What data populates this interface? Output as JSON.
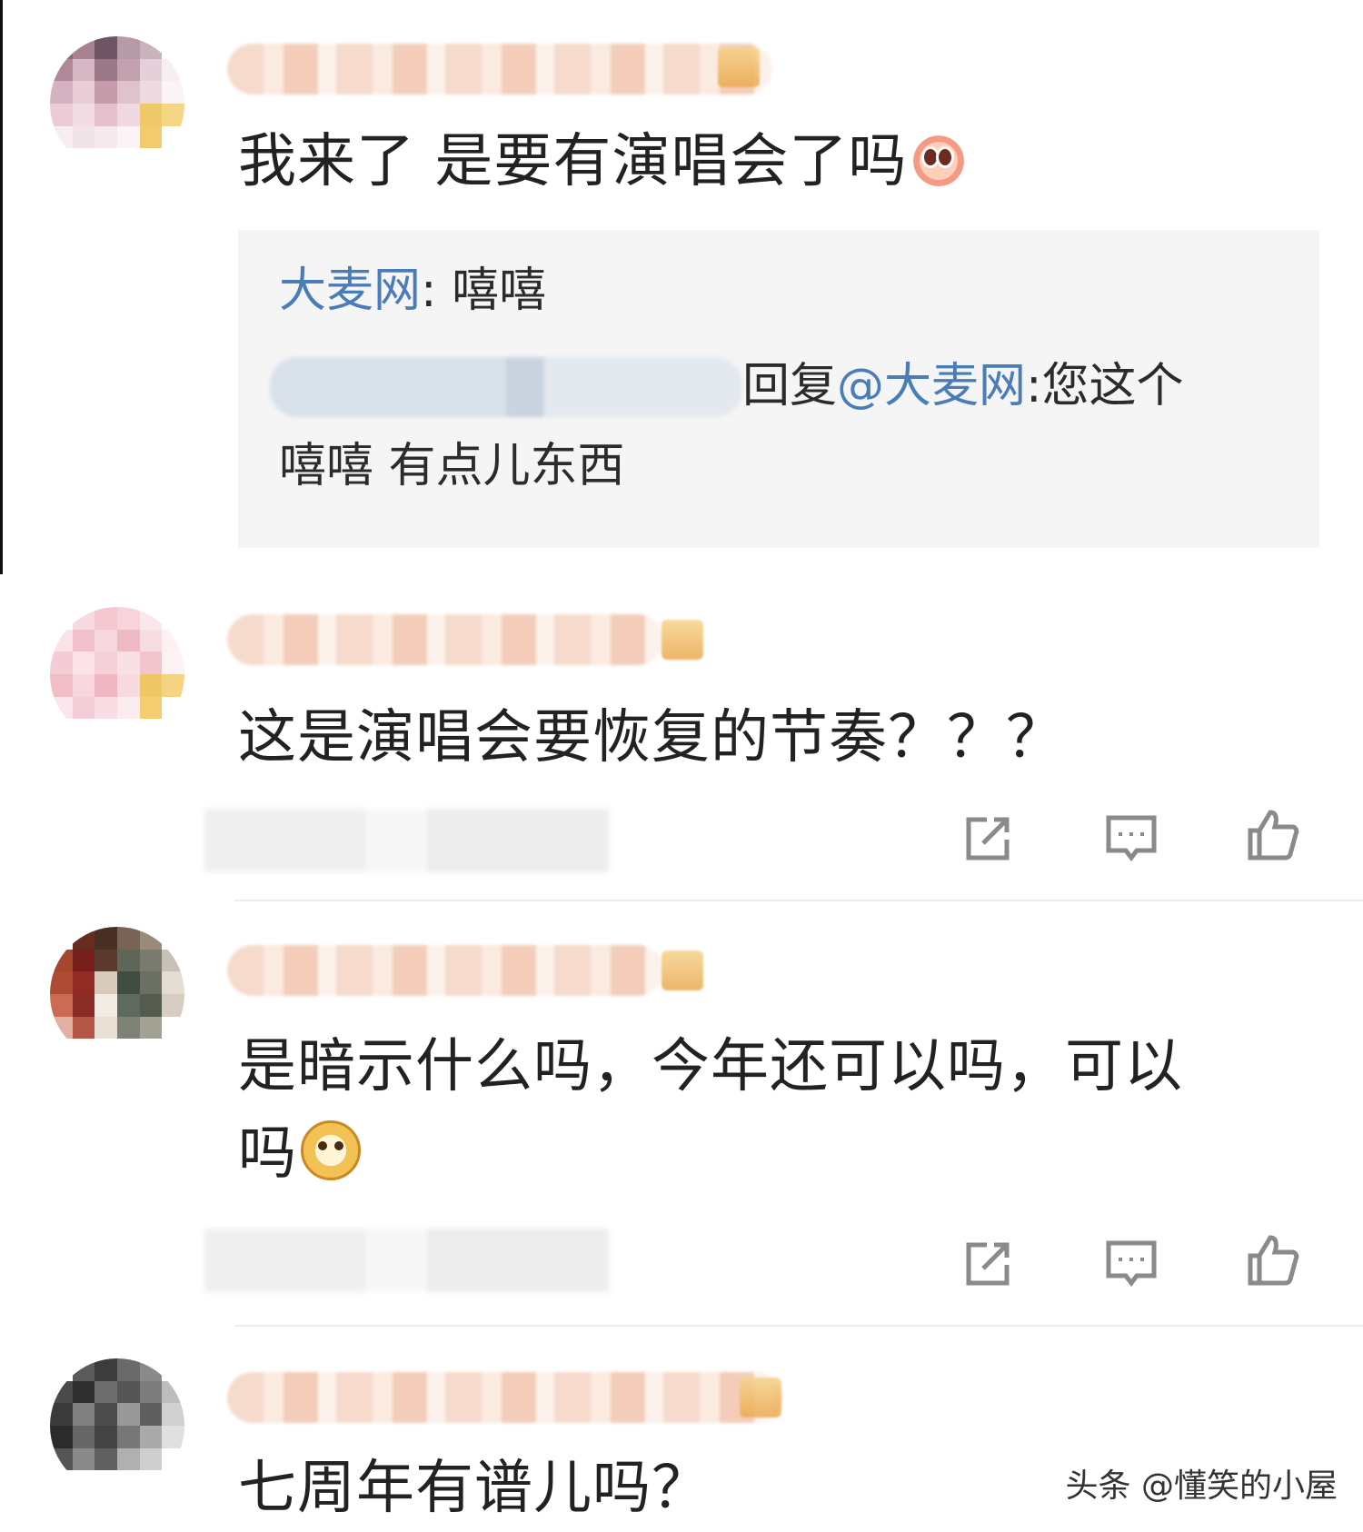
{
  "comments": [
    {
      "text": "我来了 是要有演唱会了吗",
      "emoji": "shy-face-emoji",
      "reply": {
        "line1_author": "大麦网",
        "line1_text": ": 嘻嘻",
        "line2_action": "回复",
        "line2_mention": "@大麦网",
        "line2_text": ":您这个",
        "line3_text": "嘻嘻 有点儿东西"
      }
    },
    {
      "text": "这是演唱会要恢复的节奏？？？"
    },
    {
      "text_line1": "是暗示什么吗，今年还可以吗，可以",
      "text_line2": "吗",
      "emoji": "doge-emoji"
    },
    {
      "text": "七周年有谱儿吗？"
    }
  ],
  "actions": {
    "share_icon": "share-icon",
    "comment_icon": "comment-icon",
    "like_icon": "thumbs-up-icon"
  },
  "watermark": "头条 @懂笑的小屋",
  "colors": {
    "link_blue": "#4a7db8",
    "reply_bg": "#f5f5f5",
    "icon_gray": "#8a8a8a"
  }
}
